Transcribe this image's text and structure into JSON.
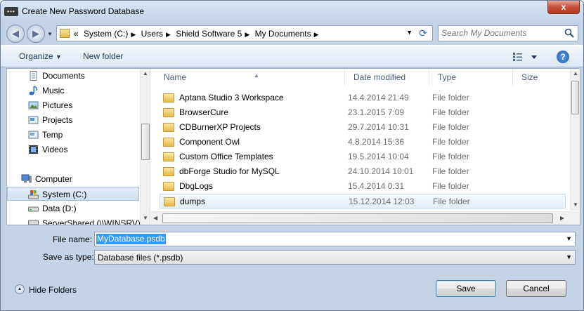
{
  "window": {
    "title": "Create New Password Database",
    "close_label": "x"
  },
  "address": {
    "breadcrumbs": [
      "System (C:)",
      "Users",
      "Shield Software 5",
      "My Documents"
    ],
    "lead": "«",
    "search_placeholder": "Search My Documents"
  },
  "toolbar": {
    "organize_label": "Organize",
    "new_folder_label": "New folder",
    "help_label": "?"
  },
  "nav": {
    "items": [
      {
        "label": "Documents",
        "icon": "documents-icon"
      },
      {
        "label": "Music",
        "icon": "music-icon"
      },
      {
        "label": "Pictures",
        "icon": "pictures-icon"
      },
      {
        "label": "Projects",
        "icon": "projects-icon"
      },
      {
        "label": "Temp",
        "icon": "temp-icon"
      },
      {
        "label": "Videos",
        "icon": "videos-icon"
      },
      {
        "label": "Computer",
        "icon": "computer-icon"
      },
      {
        "label": "System (C:)",
        "icon": "drive-icon"
      },
      {
        "label": "Data (D:)",
        "icon": "drive-icon"
      },
      {
        "label": "ServerShared (\\\\WINSRV)",
        "icon": "network-drive-icon"
      }
    ]
  },
  "files": {
    "columns": [
      "Name",
      "Date modified",
      "Type",
      "Size"
    ],
    "rows": [
      {
        "name": "Aptana Studio 3 Workspace",
        "date": "14.4.2014 21:49",
        "type": "File folder"
      },
      {
        "name": "BrowserCure",
        "date": "23.1.2015 7:09",
        "type": "File folder"
      },
      {
        "name": "CDBurnerXP Projects",
        "date": "29.7.2014 10:31",
        "type": "File folder"
      },
      {
        "name": "Component Owl",
        "date": "4.8.2014 15:36",
        "type": "File folder"
      },
      {
        "name": "Custom Office Templates",
        "date": "19.5.2014 10:04",
        "type": "File folder"
      },
      {
        "name": "dbForge Studio for MySQL",
        "date": "24.10.2014 10:01",
        "type": "File folder"
      },
      {
        "name": "DbgLogs",
        "date": "15.4.2014 0:31",
        "type": "File folder"
      },
      {
        "name": "dumps",
        "date": "15.12.2014 12:03",
        "type": "File folder"
      }
    ]
  },
  "form": {
    "file_name_label": "File name:",
    "file_name_value": "MyDatabase.psdb",
    "save_type_label": "Save as type:",
    "save_type_value": "Database files (*.psdb)"
  },
  "footer": {
    "hide_folders_label": "Hide Folders",
    "save_label": "Save",
    "cancel_label": "Cancel"
  }
}
